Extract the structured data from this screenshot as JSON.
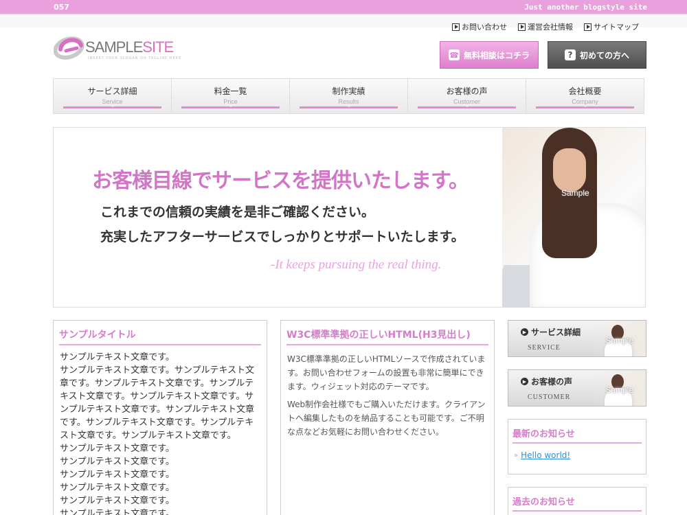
{
  "topbar": {
    "number": "057",
    "tagline": "Just another blogstyle site"
  },
  "logo": {
    "text_main": "SAMPLE",
    "text_accent": "SITE",
    "subtitle": "INSERT YOUR SLOGAN OR TAGLINE HERE"
  },
  "toplinks": [
    {
      "label": "お問い合わせ"
    },
    {
      "label": "運営会社情報"
    },
    {
      "label": "サイトマップ"
    }
  ],
  "header_buttons": {
    "consult": "無料相談はコチラ",
    "first": "初めての方へ"
  },
  "nav": [
    {
      "jp": "サービス詳細",
      "en": "Service"
    },
    {
      "jp": "料金一覧",
      "en": "Price"
    },
    {
      "jp": "制作実績",
      "en": "Results"
    },
    {
      "jp": "お客様の声",
      "en": "Customer"
    },
    {
      "jp": "会社概要",
      "en": "Company"
    }
  ],
  "hero": {
    "headline": "お客様目線でサービスを提供いたします。",
    "line1": "これまでの信頼の実績を是非ご確認ください。",
    "line2": "充実したアフターサービスでしっかりとサポートいたします。",
    "english": "-It keeps pursuing the real thing.",
    "sample_label": "Sample"
  },
  "col1": {
    "title": "サンプルタイトル",
    "body": "サンプルテキスト文章です。\nサンプルテキスト文章です。サンプルテキスト文\n章です。サンプルテキスト文章です。サンプルテ\nキスト文章です。サンプルテキスト文章です。サ\nンプルテキスト文章です。サンプルテキスト文章\nです。サンプルテキスト文章です。サンプルテキ\nスト文章です。サンプルテキスト文章です。\nサンプルテキスト文章です。\nサンプルテキスト文章です。\nサンプルテキスト文章です。\nサンプルテキスト文章です。\nサンプルテキスト文章です。\nサンプルテキスト文章です。"
  },
  "col2": {
    "title": "W3C標準準拠の正しいHTML(H3見出し)",
    "p1": "W3C標準準拠の正しいHTMLソースで作成されています。お問い合わせフォームの設置も非常に簡単にできます。ウィジェット対応のテーマです。",
    "p2": "Web制作会社様でもご購入いただけます。クライアントへ編集したものを納品することも可能です。ご不明な点などお気軽にお問い合わせください。"
  },
  "sidebar": {
    "banner_service": {
      "label": "サービス詳細",
      "en": "SERVICE",
      "sample": "Sample"
    },
    "banner_customer": {
      "label": "お客様の声",
      "en": "CUSTOMER",
      "sample": "Sample"
    },
    "news_title": "最新のお知らせ",
    "news_items": [
      {
        "label": "Hello world!"
      }
    ],
    "archive_title": "過去のお知らせ"
  },
  "colors": {
    "accent": "#e28ad6",
    "topbar": "#e9a0dc",
    "link": "#2f8fd6"
  }
}
